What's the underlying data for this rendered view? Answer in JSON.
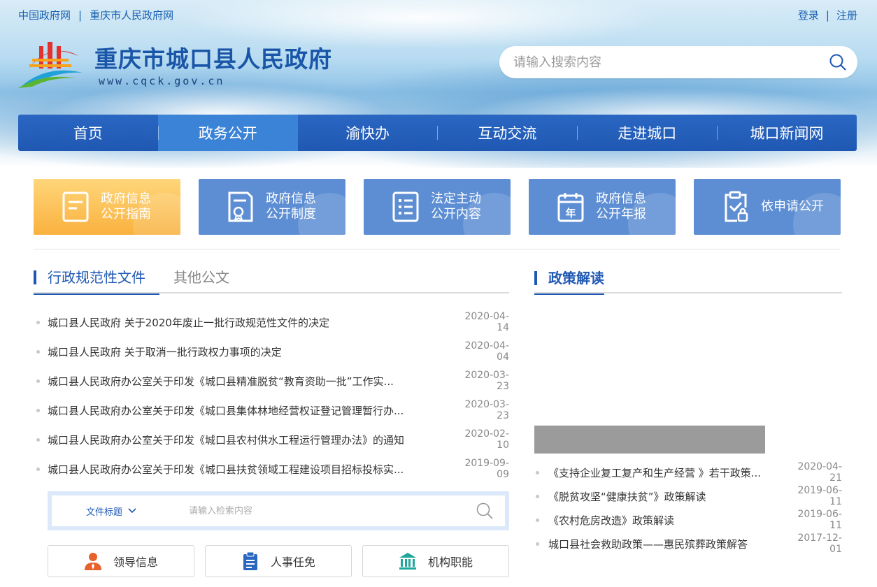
{
  "header": {
    "top_links": [
      "中国政府网",
      "重庆市人民政府网"
    ],
    "separator": "|",
    "user_links": {
      "login": "登录",
      "register": "注册"
    },
    "site_title": "重庆市城口县人民政府",
    "site_url": "www.cqck.gov.cn",
    "search_placeholder": "请输入搜索内容"
  },
  "nav": {
    "items": [
      "首页",
      "政务公开",
      "渝快办",
      "互动交流",
      "走进城口",
      "城口新闻网"
    ],
    "active_index": 1
  },
  "quick_cards": [
    {
      "label": "政府信息\n公开指南",
      "icon": "guide-document-icon",
      "color": "#f9b13e"
    },
    {
      "label": "政府信息\n公开制度",
      "icon": "certificate-document-icon",
      "color": "#5d8ed3"
    },
    {
      "label": "法定主动\n公开内容",
      "icon": "list-icon",
      "color": "#5d8ed3"
    },
    {
      "label": "政府信息\n公开年报",
      "icon": "calendar-year-icon",
      "color": "#5d8ed3"
    },
    {
      "label": "依申请公开",
      "icon": "clipboard-check-icon",
      "color": "#5d8ed3"
    }
  ],
  "documents": {
    "tabs": [
      "行政规范性文件",
      "其他公文"
    ],
    "active_tab": 0,
    "items": [
      {
        "title": "城口县人民政府 关于2020年废止一批行政规范性文件的决定",
        "date": "2020-04-14"
      },
      {
        "title": "城口县人民政府 关于取消一批行政权力事项的决定",
        "date": "2020-04-04"
      },
      {
        "title": "城口县人民政府办公室关于印发《城口县精准脱贫“教育资助一批”工作实...",
        "date": "2020-03-23"
      },
      {
        "title": "城口县人民政府办公室关于印发《城口县集体林地经营权证登记管理暂行办...",
        "date": "2020-03-23"
      },
      {
        "title": "城口县人民政府办公室关于印发《城口县农村供水工程运行管理办法》的通知",
        "date": "2020-02-10"
      },
      {
        "title": "城口县人民政府办公室关于印发《城口县扶贫领域工程建设项目招标投标实...",
        "date": "2019-09-09"
      }
    ],
    "search": {
      "select_label": "文件标题",
      "placeholder": "请输入检索内容"
    },
    "buttons": [
      {
        "label": "领导信息",
        "icon": "person-icon",
        "color": "#e8612c"
      },
      {
        "label": "人事任免",
        "icon": "clipboard-icon",
        "color": "#2a67c2"
      },
      {
        "label": "机构职能",
        "icon": "institution-icon",
        "color": "#1fa69b"
      }
    ]
  },
  "policy": {
    "title": "政策解读",
    "items": [
      {
        "title": "《支持企业复工复产和生产经营 》若干政策...",
        "date": "2020-04-21"
      },
      {
        "title": "《脱贫攻坚“健康扶贫”》政策解读",
        "date": "2019-06-11"
      },
      {
        "title": "《农村危房改造》政策解读",
        "date": "2019-06-11"
      },
      {
        "title": "城口县社会救助政策——惠民殡葬政策解答",
        "date": "2017-12-01"
      }
    ]
  }
}
